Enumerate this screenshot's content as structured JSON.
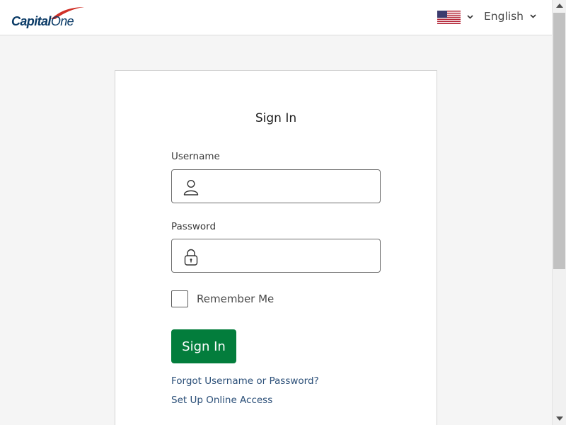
{
  "header": {
    "logo_text_bold": "Capital",
    "logo_text_light": "One",
    "flag_icon": "us-flag-icon",
    "language_label": "English"
  },
  "signin": {
    "title": "Sign In",
    "username_label": "Username",
    "username_value": "",
    "password_label": "Password",
    "password_value": "",
    "remember_label": "Remember Me",
    "remember_checked": false,
    "button_label": "Sign In",
    "forgot_link": "Forgot Username or Password?",
    "setup_link": "Set Up Online Access"
  },
  "icons": {
    "username": "user-icon",
    "password": "lock-icon",
    "chevron": "chevron-down-icon"
  },
  "colors": {
    "brand_navy": "#0a3a66",
    "brand_red": "#d03027",
    "signin_button": "#037d3c",
    "link": "#2b4f78"
  }
}
